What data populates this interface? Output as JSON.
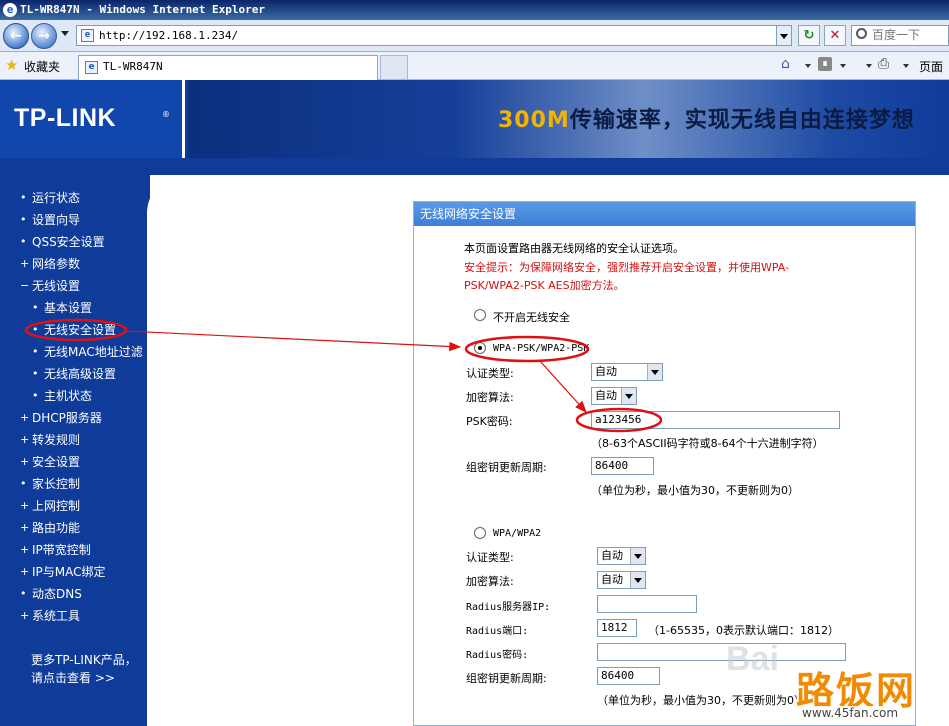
{
  "window": {
    "title": "TL-WR847N - Windows Internet Explorer"
  },
  "browser": {
    "url": "http://192.168.1.234/",
    "search_placeholder": "百度一下",
    "favorites_label": "收藏夹",
    "tab_title": "TL-WR847N",
    "page_menu": "页面"
  },
  "banner": {
    "logo": "TP-LINK",
    "slogan_highlight": "300M",
    "slogan_rest": "传输速率，实现无线自由连接梦想"
  },
  "sidebar": {
    "items": [
      {
        "bullet": "•",
        "label": "运行状态",
        "sub": false
      },
      {
        "bullet": "•",
        "label": "设置向导",
        "sub": false
      },
      {
        "bullet": "•",
        "label": "QSS安全设置",
        "sub": false
      },
      {
        "bullet": "+",
        "label": "网络参数",
        "sub": false
      },
      {
        "bullet": "−",
        "label": "无线设置",
        "sub": false
      },
      {
        "bullet": "•",
        "label": "基本设置",
        "sub": true
      },
      {
        "bullet": "•",
        "label": "无线安全设置",
        "sub": true
      },
      {
        "bullet": "•",
        "label": "无线MAC地址过滤",
        "sub": true
      },
      {
        "bullet": "•",
        "label": "无线高级设置",
        "sub": true
      },
      {
        "bullet": "•",
        "label": "主机状态",
        "sub": true
      },
      {
        "bullet": "+",
        "label": "DHCP服务器",
        "sub": false
      },
      {
        "bullet": "+",
        "label": "转发规则",
        "sub": false
      },
      {
        "bullet": "+",
        "label": "安全设置",
        "sub": false
      },
      {
        "bullet": "•",
        "label": "家长控制",
        "sub": false
      },
      {
        "bullet": "+",
        "label": "上网控制",
        "sub": false
      },
      {
        "bullet": "+",
        "label": "路由功能",
        "sub": false
      },
      {
        "bullet": "+",
        "label": "IP带宽控制",
        "sub": false
      },
      {
        "bullet": "+",
        "label": "IP与MAC绑定",
        "sub": false
      },
      {
        "bullet": "•",
        "label": "动态DNS",
        "sub": false
      },
      {
        "bullet": "+",
        "label": "系统工具",
        "sub": false
      }
    ],
    "more_line1": "更多TP-LINK产品，",
    "more_line2": "请点击查看 >>"
  },
  "panel": {
    "title": "无线网络安全设置",
    "intro": "本页面设置路由器无线网络的安全认证选项。",
    "warning_line1": "安全提示：为保障网络安全，强烈推荐开启安全设置，并使用WPA-",
    "warning_line2": "PSK/WPA2-PSK AES加密方法。",
    "option_none": "不开启无线安全",
    "option_psk": "WPA-PSK/WPA2-PSK",
    "psk": {
      "auth_label": "认证类型:",
      "auth_value": "自动",
      "enc_label": "加密算法:",
      "enc_value": "自动",
      "key_label": "PSK密码:",
      "key_value": "a123456",
      "key_hint": "（8-63个ASCII码字符或8-64个十六进制字符）",
      "renew_label": "组密钥更新周期:",
      "renew_value": "86400",
      "renew_hint": "（单位为秒，最小值为30，不更新则为0）"
    },
    "option_wpa": "WPA/WPA2",
    "wpa": {
      "auth_label": "认证类型:",
      "auth_value": "自动",
      "enc_label": "加密算法:",
      "enc_value": "自动",
      "radius_ip_label": "Radius服务器IP:",
      "radius_ip_value": "",
      "radius_port_label": "Radius端口:",
      "radius_port_value": "1812",
      "radius_port_hint": "（1-65535，0表示默认端口：1812）",
      "radius_pwd_label": "Radius密码:",
      "radius_pwd_value": "",
      "renew_label": "组密钥更新周期:",
      "renew_value": "86400",
      "renew_hint": "（单位为秒，最小值为30，不更新则为0）"
    }
  },
  "watermark": {
    "baidu": "Bai",
    "site_big": "路饭网",
    "site_url": "www.45fan.com"
  },
  "colors": {
    "sidebar_bg": "#0f3c9b",
    "annotation_red": "#e01010",
    "warning_red": "#d21010",
    "panel_header": "#3a7fd6"
  }
}
